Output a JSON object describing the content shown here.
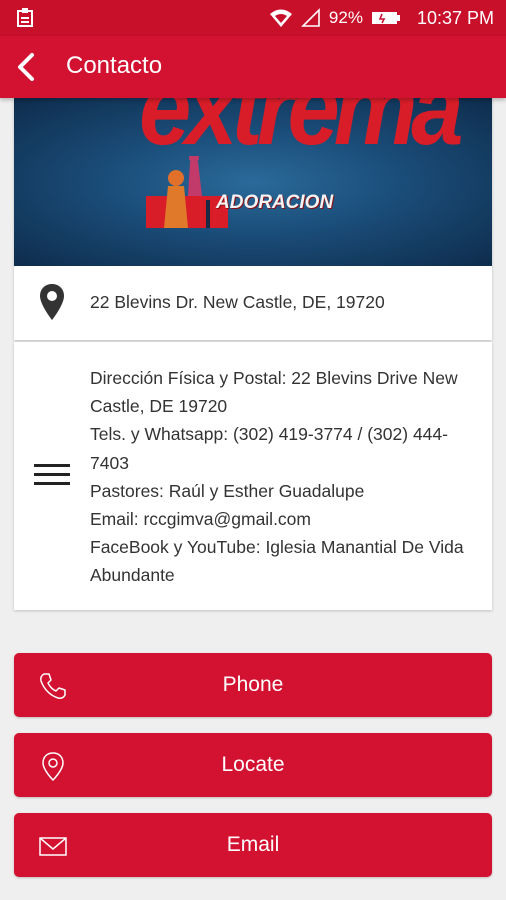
{
  "status_bar": {
    "battery": "92%",
    "time": "10:37 PM",
    "icons": [
      "notification-icon",
      "wifi-icon",
      "signal-icon",
      "battery-icon"
    ]
  },
  "app_bar": {
    "title": "Contacto",
    "back_icon": "back-arrow-icon"
  },
  "banner": {
    "logo_word": "extrema",
    "logo_subtitle": "ADORACION"
  },
  "address": {
    "icon": "location-pin-icon",
    "text": "22 Blevins Dr. New Castle, DE, 19720"
  },
  "info": {
    "icon": "menu-lines-icon",
    "lines": [
      "Dirección Física y Postal: 22 Blevins Drive New Castle, DE 19720",
      "Tels. y Whatsapp: (302) 419-3774 / (302) 444-7403",
      "Pastores: Raúl y Esther Guadalupe",
      "Email: rccgimva@gmail.com",
      "FaceBook y YouTube: Iglesia Manantial De Vida Abundante"
    ]
  },
  "actions": {
    "phone": {
      "label": "Phone",
      "icon": "phone-icon"
    },
    "locate": {
      "label": "Locate",
      "icon": "map-pin-icon"
    },
    "email": {
      "label": "Email",
      "icon": "envelope-icon"
    }
  },
  "colors": {
    "primary": "#d31130",
    "status_bar": "#c9102b",
    "background": "#efefef"
  }
}
